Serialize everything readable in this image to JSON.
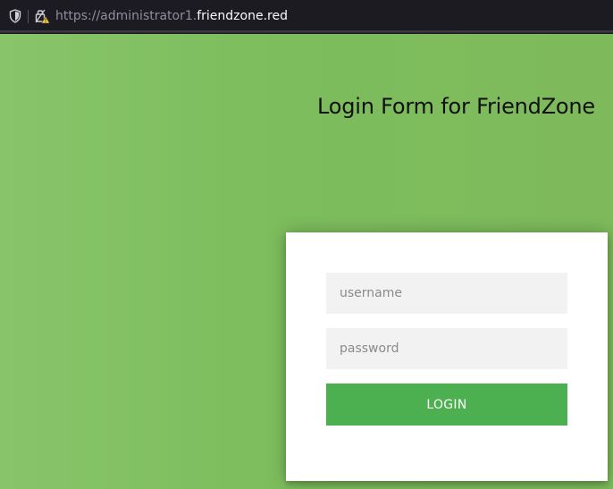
{
  "browser": {
    "url_prefix": "https://administrator1.",
    "url_domain": "friendzone.red",
    "icons": {
      "tracking_protection": "shield-icon",
      "connection": "insecure-lock-warning-icon"
    }
  },
  "page": {
    "title": "Login Form for FriendZone",
    "background_color": "#7fbe5e"
  },
  "login_form": {
    "username_placeholder": "username",
    "password_placeholder": "password",
    "login_label": "LOGIN",
    "button_color": "#4caf50"
  }
}
